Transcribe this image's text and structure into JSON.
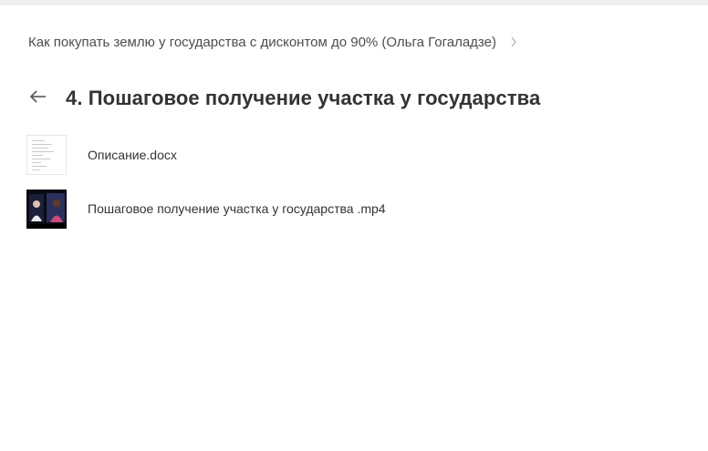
{
  "breadcrumb": {
    "parent_label": "Как покупать землю у государства с дисконтом до 90% (Ольга Гогаладзе)"
  },
  "header": {
    "title": "4. Пошаговое получение участка у государства"
  },
  "files": [
    {
      "name": "Описание.docx",
      "thumb_type": "document"
    },
    {
      "name": "Пошаговое получение участка у государства .mp4",
      "thumb_type": "video"
    }
  ],
  "colors": {
    "topbar": "#eeeeee",
    "text": "#333333",
    "muted": "#555555"
  },
  "icons": {
    "back": "arrow-left-icon",
    "breadcrumb_separator": "chevron-right-icon"
  }
}
